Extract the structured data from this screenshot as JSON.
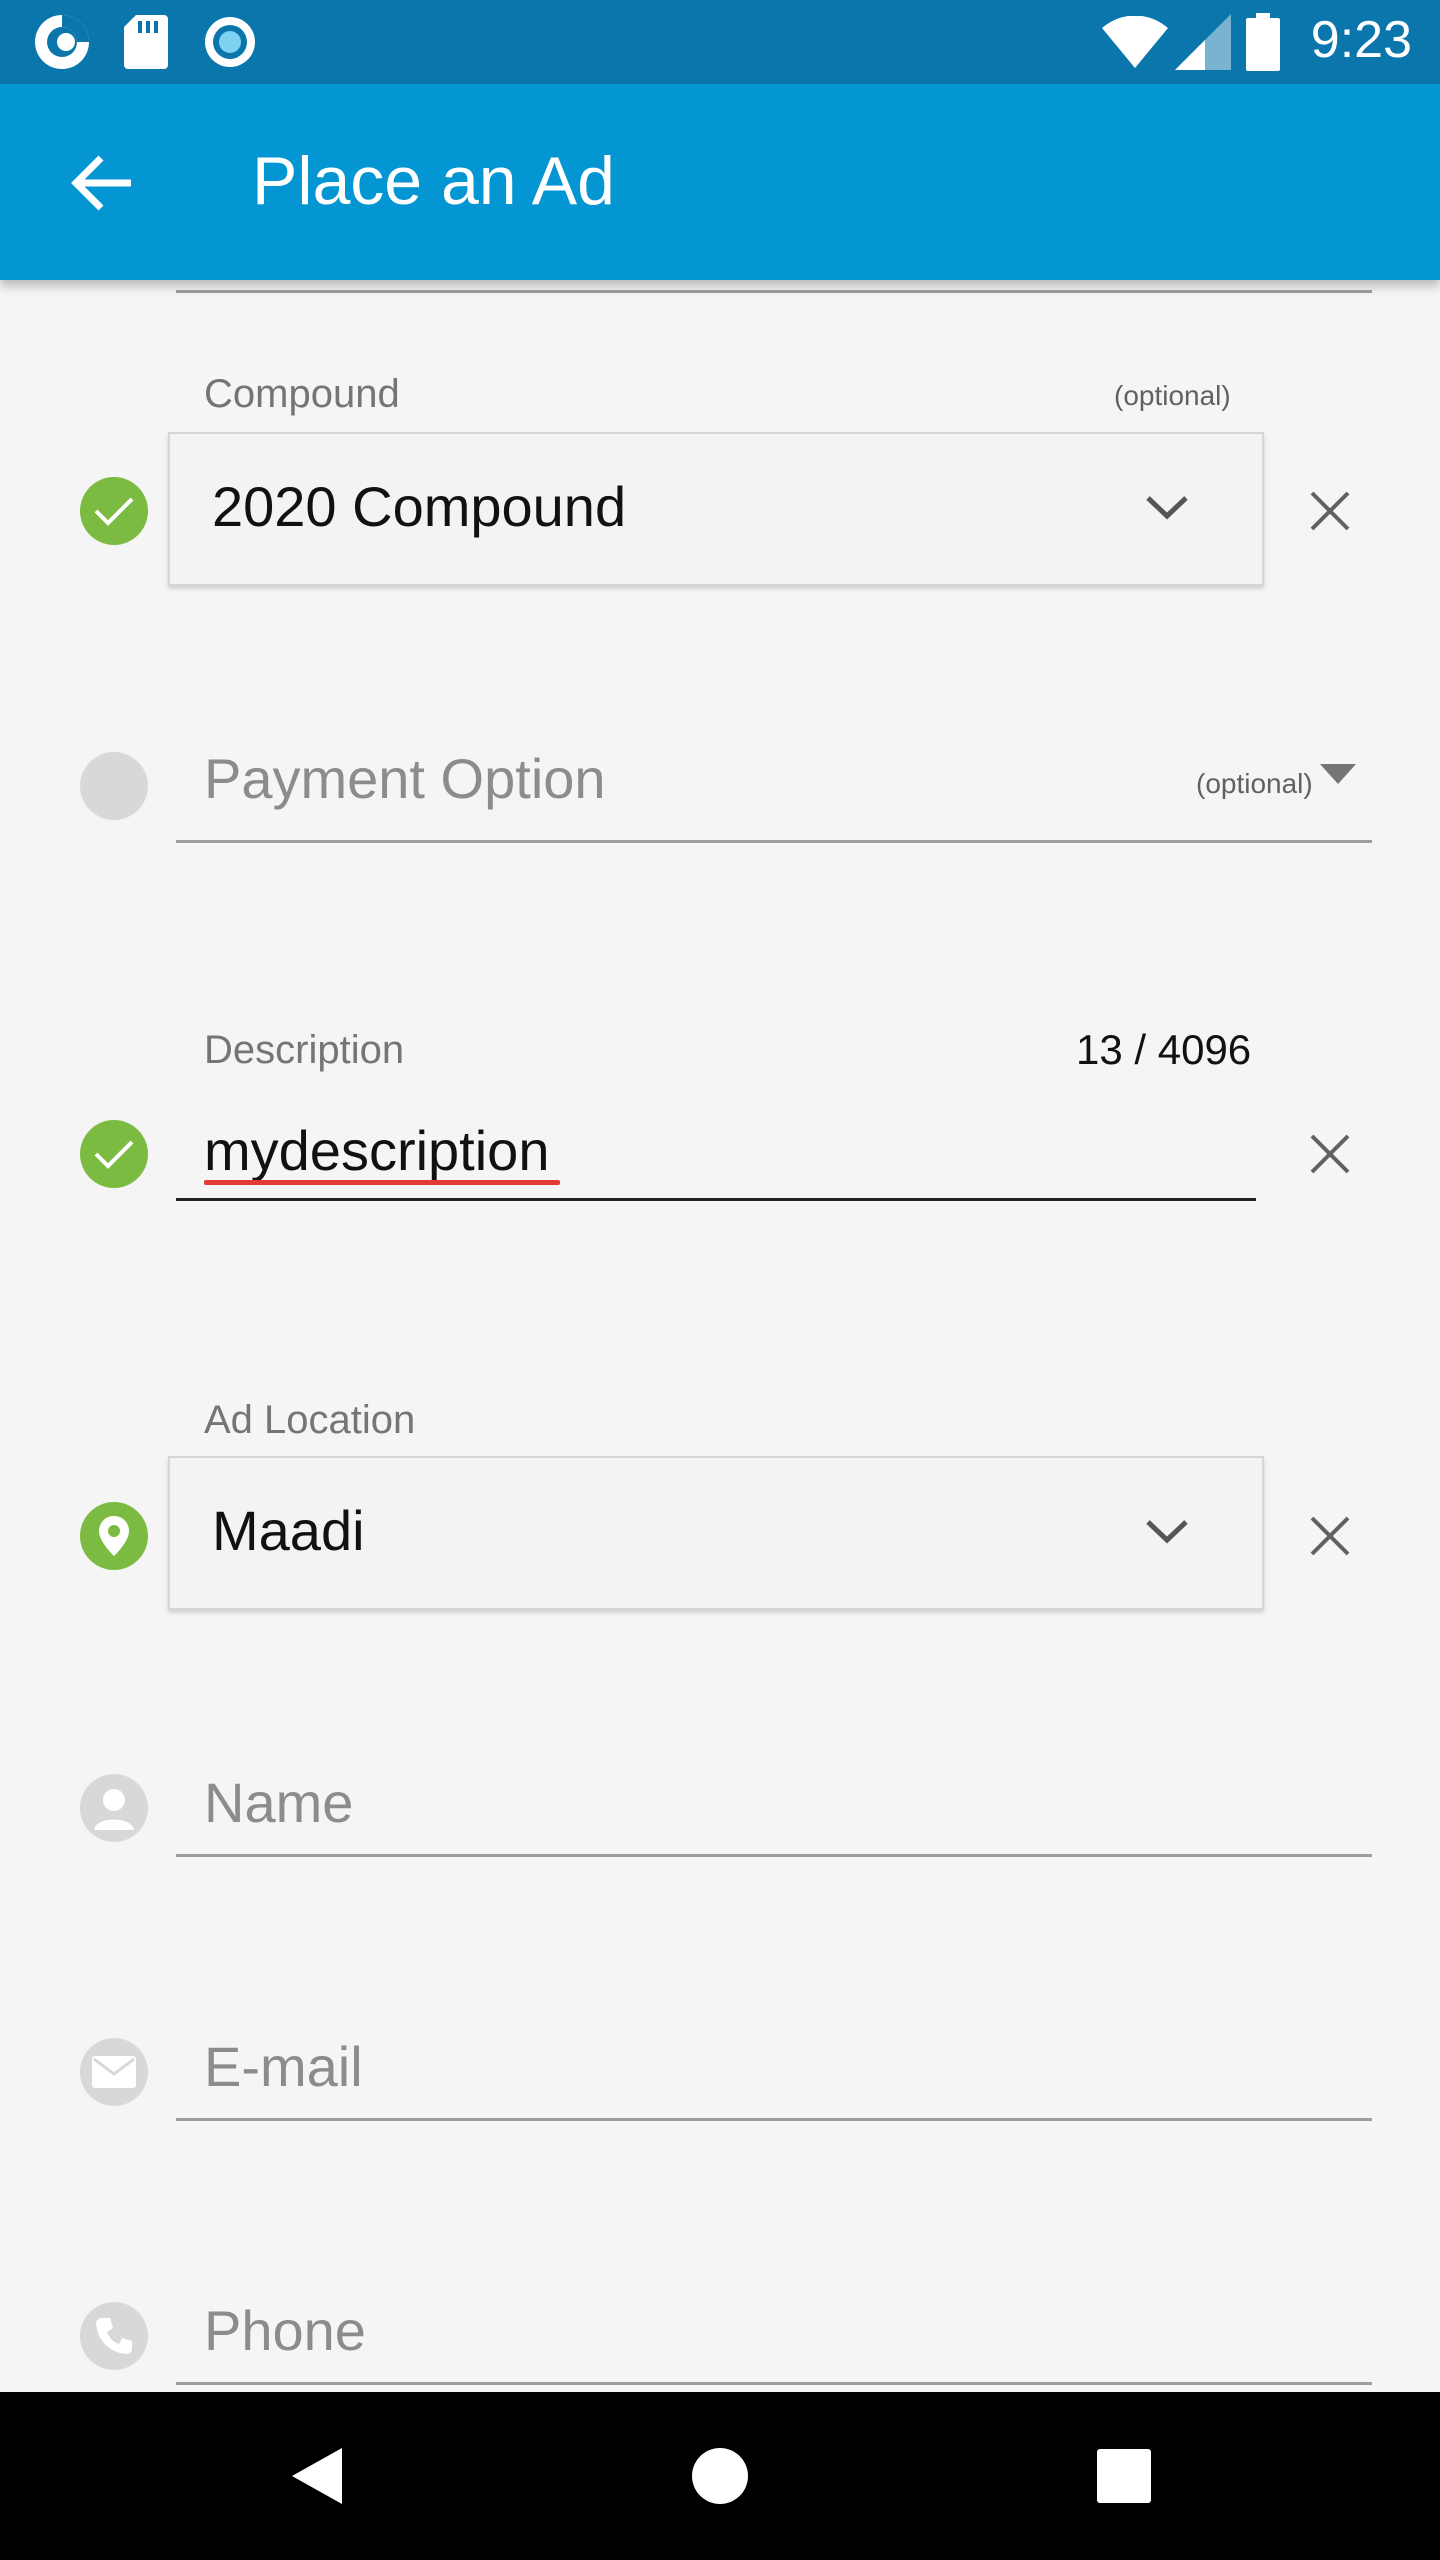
{
  "status_bar": {
    "time": "9:23",
    "left_icons": [
      "sync-app-icon",
      "sd-card-icon",
      "circle-record-icon"
    ],
    "right_icons": [
      "wifi-icon",
      "cell-signal-icon",
      "battery-icon"
    ]
  },
  "app_bar": {
    "title": "Place an Ad",
    "back_icon": "arrow-back-icon"
  },
  "form": {
    "compound": {
      "label": "Compound",
      "optional": "(optional)",
      "value": "2020 Compound",
      "status": "valid"
    },
    "payment_option": {
      "placeholder": "Payment Option",
      "optional": "(optional)",
      "status": "empty"
    },
    "description": {
      "label": "Description",
      "counter": "13 / 4096",
      "value": "mydescription",
      "status": "valid"
    },
    "ad_location": {
      "label": "Ad Location",
      "value": "Maadi",
      "status": "location"
    },
    "name": {
      "placeholder": "Name"
    },
    "email": {
      "placeholder": "E-mail"
    },
    "phone": {
      "placeholder": "Phone"
    }
  },
  "colors": {
    "status_bar": "#0b76ac",
    "app_bar": "#0396d2",
    "valid_green": "#7cbb42",
    "inactive_grey": "#d8d8d8",
    "spell_error": "#e53935"
  },
  "nav_bar": {
    "icons": [
      "nav-back-icon",
      "nav-home-icon",
      "nav-recents-icon"
    ]
  }
}
